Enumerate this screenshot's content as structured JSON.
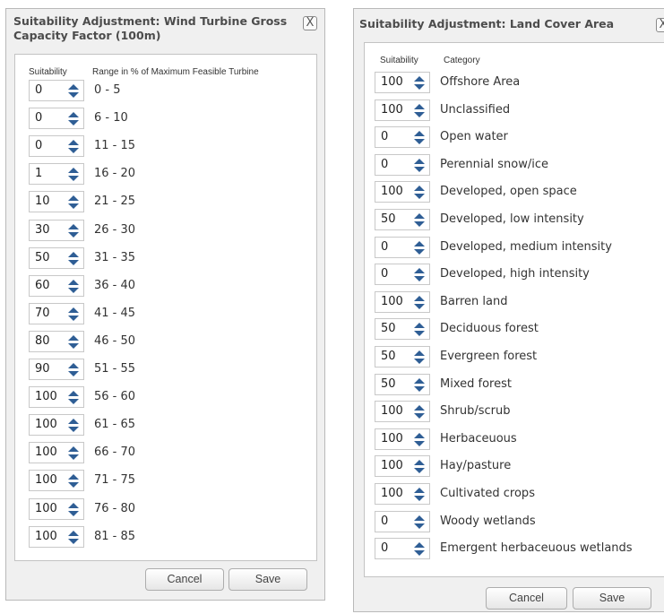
{
  "dialog1": {
    "title": "Suitability Adjustment: Wind Turbine Gross Capacity Factor (100m)",
    "close": "X",
    "header_suitability": "Suitability",
    "header_range": "Range in % of Maximum Feasible Turbine",
    "rows": [
      {
        "value": "0",
        "label": "0 - 5"
      },
      {
        "value": "0",
        "label": "6 - 10"
      },
      {
        "value": "0",
        "label": "11 - 15"
      },
      {
        "value": "1",
        "label": "16 - 20"
      },
      {
        "value": "10",
        "label": "21 - 25"
      },
      {
        "value": "30",
        "label": "26 - 30"
      },
      {
        "value": "50",
        "label": "31 - 35"
      },
      {
        "value": "60",
        "label": "36 - 40"
      },
      {
        "value": "70",
        "label": "41 - 45"
      },
      {
        "value": "80",
        "label": "46 - 50"
      },
      {
        "value": "90",
        "label": "51 - 55"
      },
      {
        "value": "100",
        "label": "56 - 60"
      },
      {
        "value": "100",
        "label": "61 - 65"
      },
      {
        "value": "100",
        "label": "66 - 70"
      },
      {
        "value": "100",
        "label": "71 - 75"
      },
      {
        "value": "100",
        "label": "76 - 80"
      },
      {
        "value": "100",
        "label": "81 - 85"
      }
    ],
    "cancel": "Cancel",
    "save": "Save"
  },
  "dialog2": {
    "title": "Suitability Adjustment: Land Cover Area",
    "close": "X",
    "header_suitability": "Suitability",
    "header_category": "Category",
    "rows": [
      {
        "value": "100",
        "label": "Offshore Area"
      },
      {
        "value": "100",
        "label": "Unclassified"
      },
      {
        "value": "0",
        "label": "Open water"
      },
      {
        "value": "0",
        "label": "Perennial snow/ice"
      },
      {
        "value": "100",
        "label": "Developed, open space"
      },
      {
        "value": "50",
        "label": "Developed, low intensity"
      },
      {
        "value": "0",
        "label": "Developed, medium intensity"
      },
      {
        "value": "0",
        "label": "Developed, high intensity"
      },
      {
        "value": "100",
        "label": "Barren land"
      },
      {
        "value": "50",
        "label": "Deciduous forest"
      },
      {
        "value": "50",
        "label": "Evergreen forest"
      },
      {
        "value": "50",
        "label": "Mixed forest"
      },
      {
        "value": "100",
        "label": "Shrub/scrub"
      },
      {
        "value": "100",
        "label": "Herbaceuous"
      },
      {
        "value": "100",
        "label": "Hay/pasture"
      },
      {
        "value": "100",
        "label": "Cultivated crops"
      },
      {
        "value": "0",
        "label": "Woody wetlands"
      },
      {
        "value": "0",
        "label": "Emergent herbaceuous wetlands"
      }
    ],
    "cancel": "Cancel",
    "save": "Save"
  }
}
